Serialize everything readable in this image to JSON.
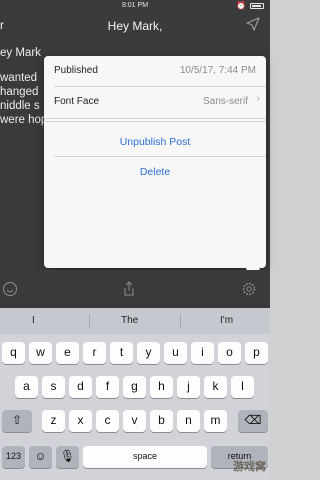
{
  "status": {
    "time": "8:01 PM",
    "carrier": ""
  },
  "nav": {
    "title": "Hey Mark,",
    "back_label": "r"
  },
  "editor": {
    "title": "ey Mark",
    "lines": [
      "wanted",
      "hanged",
      "niddle s",
      "were hop"
    ]
  },
  "popover": {
    "published_label": "Published",
    "published_value": "10/5/17, 7:44 PM",
    "font_label": "Font Face",
    "font_value": "Sans-serif",
    "unpublish_label": "Unpublish Post",
    "delete_label": "Delete"
  },
  "keyboard": {
    "predictions": [
      "I",
      "The",
      "I'm"
    ],
    "row1": [
      "q",
      "w",
      "e",
      "r",
      "t",
      "y",
      "u",
      "i",
      "o",
      "p"
    ],
    "row2": [
      "a",
      "s",
      "d",
      "f",
      "g",
      "h",
      "j",
      "k",
      "l"
    ],
    "row3": [
      "z",
      "x",
      "c",
      "v",
      "b",
      "n",
      "m"
    ],
    "space_label": "space",
    "mode_label": "123",
    "return_label": "return"
  },
  "watermark": "游戏窝"
}
